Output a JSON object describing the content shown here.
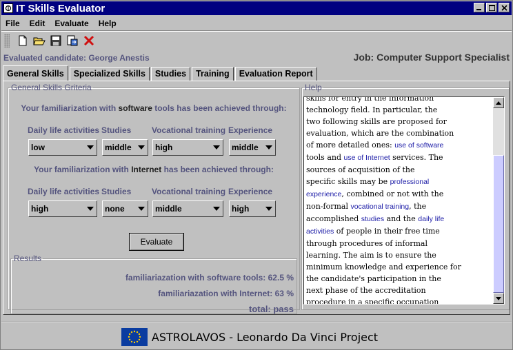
{
  "window": {
    "title": "IT Skills Evaluator"
  },
  "menu": [
    "File",
    "Edit",
    "Evaluate",
    "Help"
  ],
  "toolbar": {
    "icons": [
      "new-file-icon",
      "open-folder-icon",
      "save-icon",
      "export-icon",
      "delete-icon"
    ]
  },
  "header": {
    "candidate": "Evaluated candidate: George Anestis",
    "job": "Job: Computer Support Specialist"
  },
  "tabs": [
    "General Skills",
    "Specialized Skills",
    "Studies",
    "Training",
    "Evaluation Report"
  ],
  "active_tab": "General Skills",
  "criteria": {
    "legend": "General Skills Griteria",
    "software": {
      "q_pre": "Your familiarization with",
      "q_word": "software",
      "q_post": "tools has been achieved through:",
      "labels": [
        "Daily life activities",
        "Studies",
        "Vocational training",
        "Experience"
      ],
      "values": [
        "low",
        "middle",
        "high",
        "middle"
      ]
    },
    "internet": {
      "q_pre": "Your familiarization with",
      "q_word": "Internet",
      "q_post": "has been achieved through:",
      "labels": [
        "Daily life activities",
        "Studies",
        "Vocational training",
        "Experience"
      ],
      "values": [
        "high",
        "none",
        "middle",
        "high"
      ]
    },
    "evaluate_label": "Evaluate"
  },
  "results": {
    "legend": "Results",
    "software": "familiariazation with software tools: 62.5 %",
    "internet": "familiariazation with Internet: 63 %",
    "total": "total:  pass"
  },
  "help": {
    "legend": "Help",
    "lines": [
      [
        {
          "t": "skills for entry in the information"
        }
      ],
      [
        {
          "t": "technology field. In particular, the"
        }
      ],
      [
        {
          "t": "two following skills are proposed for"
        }
      ],
      [
        {
          "t": "evaluation, which are the combination"
        }
      ],
      [
        {
          "t": "of more detailed ones: "
        },
        {
          "t": "use of software",
          "link": true
        }
      ],
      [
        {
          "t": "tools and "
        },
        {
          "t": "use of Internet",
          "link": true
        },
        {
          "t": " services. The"
        }
      ],
      [
        {
          "t": "sources of acquisition of the"
        }
      ],
      [
        {
          "t": "specific skills may be "
        },
        {
          "t": "professional",
          "link": true
        }
      ],
      [
        {
          "t": "experience",
          "link": true
        },
        {
          "t": ", combined or not with the"
        }
      ],
      [
        {
          "t": "non-formal "
        },
        {
          "t": "vocational training",
          "link": true
        },
        {
          "t": ", the"
        }
      ],
      [
        {
          "t": "accomplished "
        },
        {
          "t": "studies",
          "link": true
        },
        {
          "t": " and the "
        },
        {
          "t": "daily life",
          "link": true
        }
      ],
      [
        {
          "t": "activities",
          "link": true
        },
        {
          "t": " of people in their free time"
        }
      ],
      [
        {
          "t": "through procedures of informal"
        }
      ],
      [
        {
          "t": "learning. The aim is to ensure the"
        }
      ],
      [
        {
          "t": "minimum knowledge and experience for"
        }
      ],
      [
        {
          "t": "the candidate's participation in the"
        }
      ],
      [
        {
          "t": "next phase of the accreditation"
        }
      ],
      [
        {
          "t": "procedure in a specific occupation"
        }
      ]
    ]
  },
  "footer": {
    "text": "ASTROLAVOS - Leonardo Da Vinci Project"
  },
  "colors": {
    "titlebar": "#000080",
    "label_text": "#54547e",
    "link": "#1a1aa6",
    "eu_blue": "#0a3ca0",
    "eu_star": "#ffcc00"
  }
}
